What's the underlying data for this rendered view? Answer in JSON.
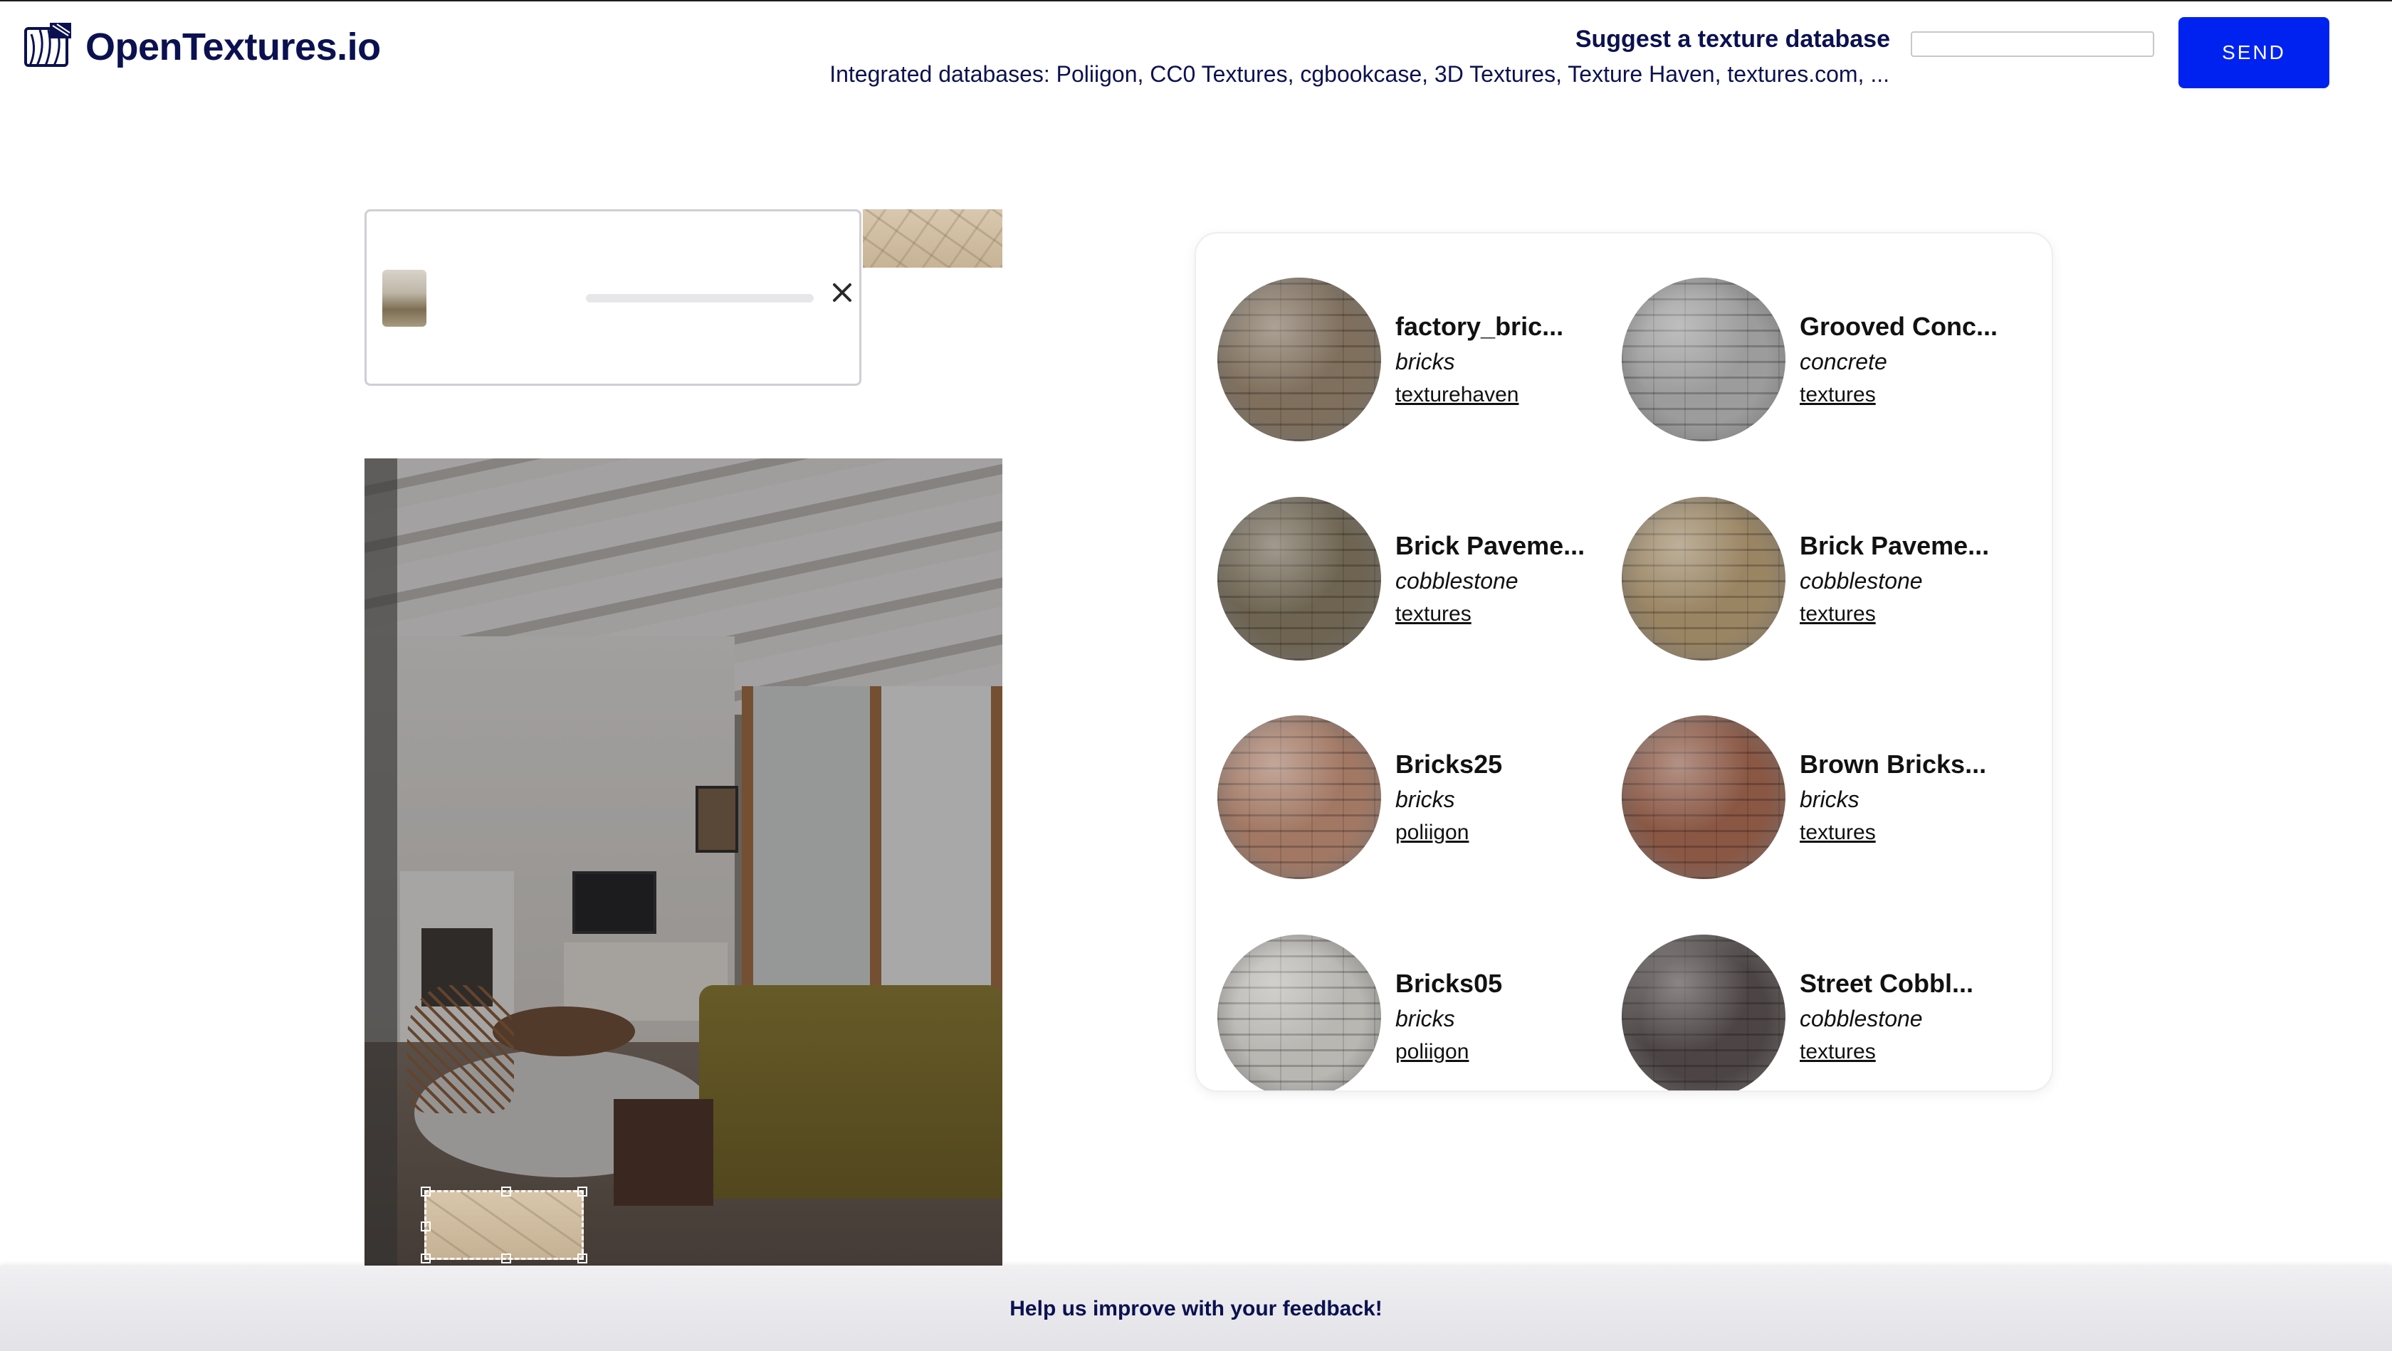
{
  "header": {
    "logo_text": "OpenTextures.io",
    "suggest_label": "Suggest a texture database",
    "integrated_text": "Integrated databases: Poliigon, CC0 Textures, cgbookcase, 3D Textures, Texture Haven, textures.com, ...",
    "suggest_input_value": "",
    "send_label": "SEND"
  },
  "upload": {
    "progress": 0.0
  },
  "results": [
    {
      "title": "factory_bric...",
      "category": "bricks",
      "source": "texturehaven",
      "color": "#7f6f5c"
    },
    {
      "title": "Grooved Conc...",
      "category": "concrete",
      "source": "textures",
      "color": "#9c9c9c"
    },
    {
      "title": "Brick Paveme...",
      "category": "cobblestone",
      "source": "textures",
      "color": "#6e6451"
    },
    {
      "title": "Brick Paveme...",
      "category": "cobblestone",
      "source": "textures",
      "color": "#9a8563"
    },
    {
      "title": "Bricks25",
      "category": "bricks",
      "source": "poliigon",
      "color": "#a27864"
    },
    {
      "title": "Brown Bricks...",
      "category": "bricks",
      "source": "textures",
      "color": "#8a5744"
    },
    {
      "title": "Bricks05",
      "category": "bricks",
      "source": "poliigon",
      "color": "#b9b7b2"
    },
    {
      "title": "Street Cobbl...",
      "category": "cobblestone",
      "source": "textures",
      "color": "#4d4545"
    }
  ],
  "footer": {
    "feedback_text": "Help us improve with your feedback!"
  },
  "colors": {
    "brand_navy": "#0b1150",
    "send_blue": "#0022f0"
  }
}
